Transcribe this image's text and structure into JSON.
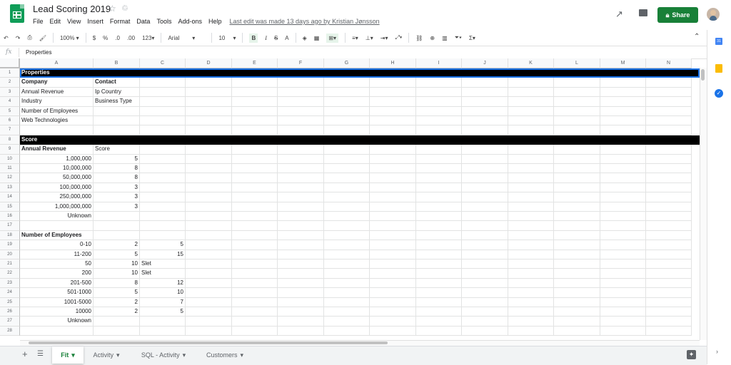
{
  "doc": {
    "title": "Lead Scoring 2019",
    "star_icon": "☆",
    "drive_icon": "♲"
  },
  "menu": [
    "File",
    "Edit",
    "View",
    "Insert",
    "Format",
    "Data",
    "Tools",
    "Add-ons",
    "Help"
  ],
  "last_edit": "Last edit was made 13 days ago by Kristian Jønsson",
  "share_label": "Share",
  "toolbar": {
    "zoom": "100%",
    "currency": "$",
    "percent": "%",
    "dec_decrease": ".0",
    "dec_increase": ".00",
    "format_more": "123",
    "font": "Arial",
    "font_size": "10",
    "bold": "B",
    "italic": "I",
    "strike": "S",
    "text_color": "A"
  },
  "formula_bar": {
    "fx": "fx",
    "value": "Properties"
  },
  "columns": [
    "A",
    "B",
    "C",
    "D",
    "E",
    "F",
    "G",
    "H",
    "I",
    "J",
    "K",
    "L",
    "M",
    "N"
  ],
  "rows": [
    {
      "n": "1",
      "a": "Properties",
      "b": "",
      "c": "",
      "style": "blk"
    },
    {
      "n": "2",
      "a": "Company",
      "b": "Contact",
      "c": "",
      "bold": true
    },
    {
      "n": "3",
      "a": "Annual Revenue",
      "b": "Ip Country",
      "c": ""
    },
    {
      "n": "4",
      "a": "Industry",
      "b": "Business Type",
      "c": ""
    },
    {
      "n": "5",
      "a": "Number of Employees",
      "b": "",
      "c": ""
    },
    {
      "n": "6",
      "a": "Web Technologies",
      "b": "",
      "c": ""
    },
    {
      "n": "7",
      "a": "",
      "b": "",
      "c": ""
    },
    {
      "n": "8",
      "a": "Score",
      "b": "",
      "c": "",
      "style": "blk"
    },
    {
      "n": "9",
      "a": "Annual Revenue",
      "b": "Score",
      "c": "",
      "abold": true
    },
    {
      "n": "10",
      "a": "1,000,000",
      "b": "5",
      "c": "",
      "num": true
    },
    {
      "n": "11",
      "a": "10,000,000",
      "b": "8",
      "c": "",
      "num": true
    },
    {
      "n": "12",
      "a": "50,000,000",
      "b": "8",
      "c": "",
      "num": true
    },
    {
      "n": "13",
      "a": "100,000,000",
      "b": "3",
      "c": "",
      "num": true
    },
    {
      "n": "14",
      "a": "250,000,000",
      "b": "3",
      "c": "",
      "num": true
    },
    {
      "n": "15",
      "a": "1,000,000,000",
      "b": "3",
      "c": "",
      "num": true
    },
    {
      "n": "16",
      "a": "Unknown",
      "b": "",
      "c": "",
      "num": true
    },
    {
      "n": "17",
      "a": "",
      "b": "",
      "c": ""
    },
    {
      "n": "18",
      "a": "Number of Employees",
      "b": "",
      "c": "",
      "abold": true
    },
    {
      "n": "19",
      "a": "0-10",
      "b": "2",
      "c": "5",
      "num": true
    },
    {
      "n": "20",
      "a": "11-200",
      "b": "5",
      "c": "15",
      "num": true
    },
    {
      "n": "21",
      "a": "50",
      "b": "10",
      "c": "Slet",
      "num": true,
      "cleft": true
    },
    {
      "n": "22",
      "a": "200",
      "b": "10",
      "c": "Slet",
      "num": true,
      "cleft": true
    },
    {
      "n": "23",
      "a": "201-500",
      "b": "8",
      "c": "12",
      "num": true
    },
    {
      "n": "24",
      "a": "501-1000",
      "b": "5",
      "c": "10",
      "num": true
    },
    {
      "n": "25",
      "a": "1001-5000",
      "b": "2",
      "c": "7",
      "num": true
    },
    {
      "n": "26",
      "a": "10000",
      "b": "2",
      "c": "5",
      "num": true
    },
    {
      "n": "27",
      "a": "Unknown",
      "b": "",
      "c": "",
      "num": true
    },
    {
      "n": "28",
      "a": "",
      "b": "",
      "c": ""
    }
  ],
  "sheets": [
    {
      "name": "Fit",
      "active": true
    },
    {
      "name": "Activity",
      "active": false
    },
    {
      "name": "SQL - Activity",
      "active": false
    },
    {
      "name": "Customers",
      "active": false
    }
  ],
  "colors": {
    "brand_green": "#0f9d58",
    "share_green": "#188038",
    "selection_blue": "#1a73e8"
  }
}
